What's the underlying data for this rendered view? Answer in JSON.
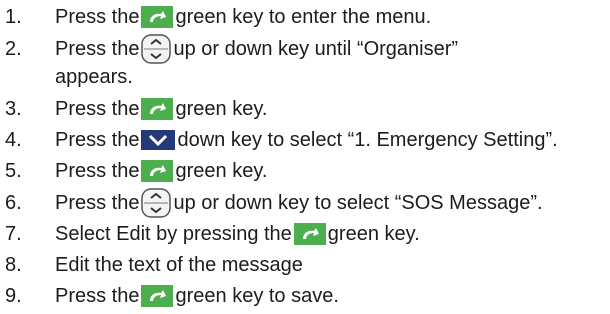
{
  "steps": [
    {
      "num": "1.",
      "before": "Press the",
      "key": "green-key",
      "after": "green key to enter the menu."
    },
    {
      "num": "2.",
      "before": "Press the",
      "key": "up-down-key",
      "after": "up or down key until “Organiser”",
      "continuation": "appears."
    },
    {
      "num": "3.",
      "before": "Press the",
      "key": "green-key",
      "after": "green key."
    },
    {
      "num": "4.",
      "before": "Press the",
      "key": "down-key",
      "after": "down key to select “1. Emergency Setting”."
    },
    {
      "num": "5.",
      "before": "Press the",
      "key": "green-key",
      "after": "green key."
    },
    {
      "num": "6.",
      "before": "Press the",
      "key": "up-down-key",
      "after": "up or down key to select “SOS Message”."
    },
    {
      "num": "7.",
      "before": "Select Edit by pressing the",
      "key": "green-key",
      "after": "green key."
    },
    {
      "num": "8.",
      "before": "Edit the text of the message",
      "key": "",
      "after": ""
    },
    {
      "num": "9.",
      "before": "Press the",
      "key": "green-key",
      "after": "green key to save."
    }
  ],
  "colors": {
    "green_key_bg": "#4cae4c",
    "down_key_bg": "#24397a",
    "text": "#1c1c1c"
  }
}
